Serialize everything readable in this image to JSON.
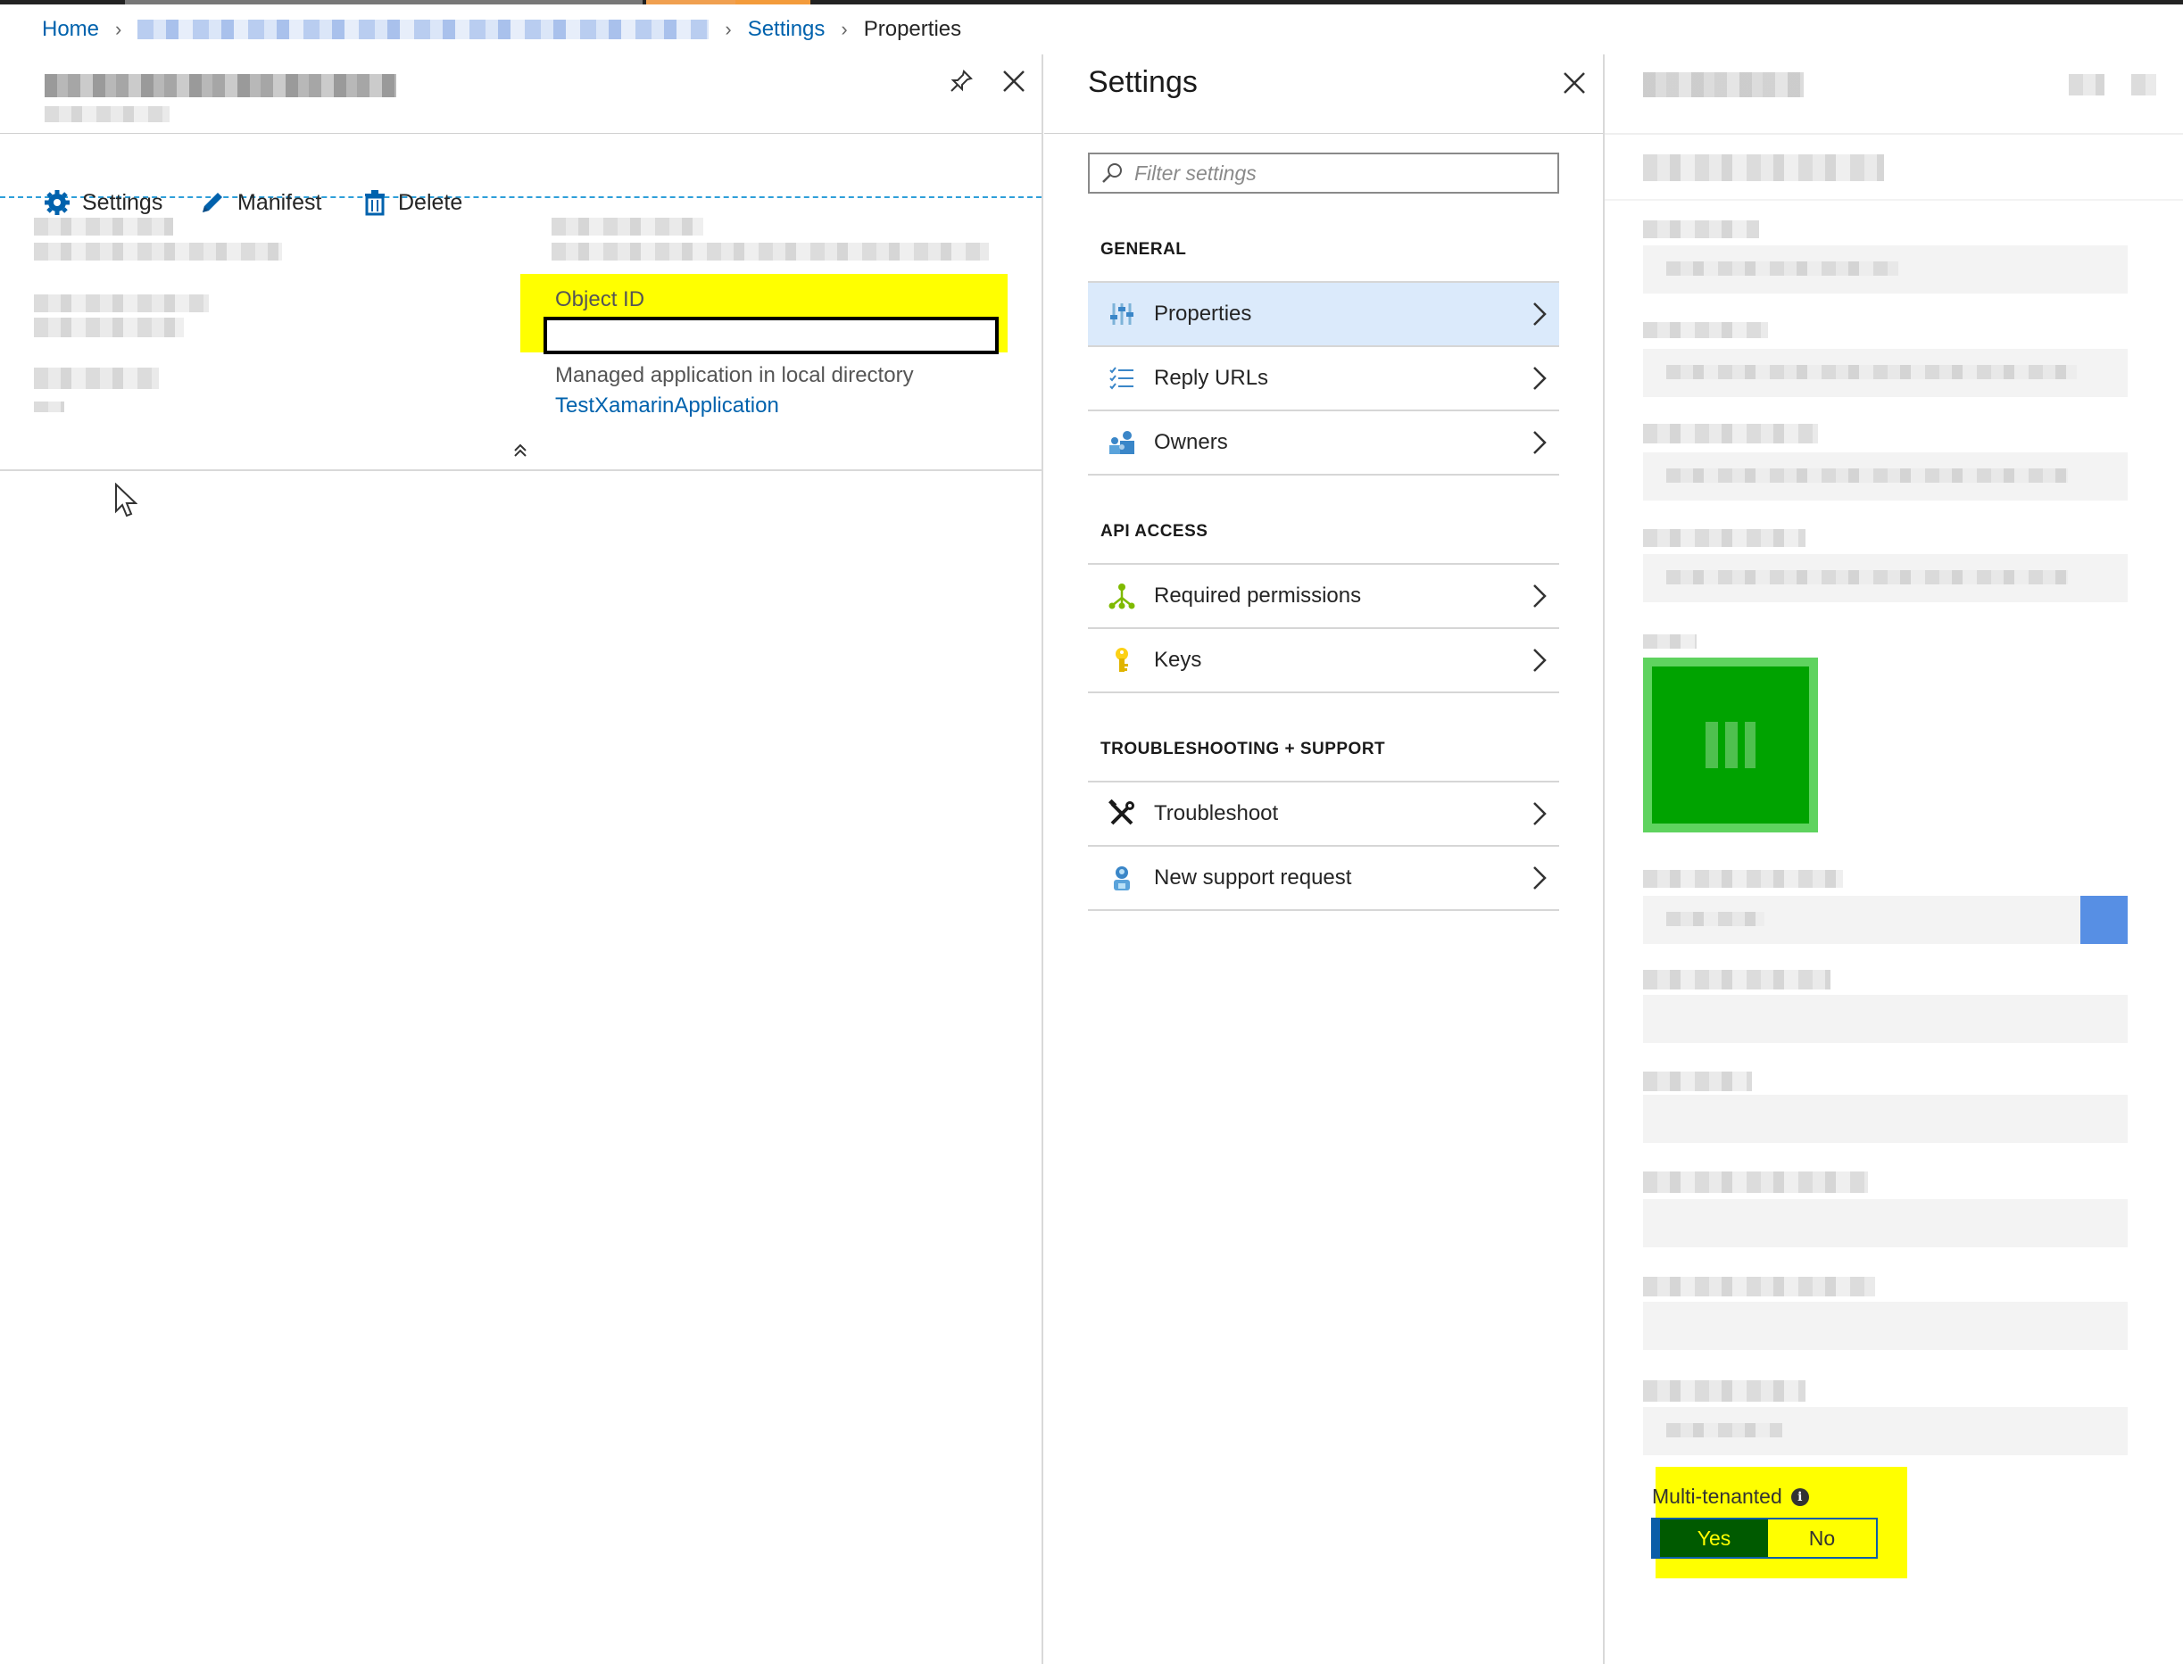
{
  "breadcrumb": {
    "home": "Home",
    "settings": "Settings",
    "current": "Properties"
  },
  "app_blade": {
    "toolbar": {
      "settings_label": "Settings",
      "manifest_label": "Manifest",
      "delete_label": "Delete"
    },
    "essentials": {
      "object_id_label": "Object ID",
      "object_id_value": "",
      "managed_app_label": "Managed application in local directory",
      "managed_app_link": "TestXamarinApplication"
    }
  },
  "settings_blade": {
    "title": "Settings",
    "filter_placeholder": "Filter settings",
    "sections": [
      {
        "heading": "GENERAL",
        "items": [
          {
            "label": "Properties",
            "icon": "properties-icon",
            "active": true
          },
          {
            "label": "Reply URLs",
            "icon": "list-icon"
          },
          {
            "label": "Owners",
            "icon": "owners-icon"
          }
        ]
      },
      {
        "heading": "API ACCESS",
        "items": [
          {
            "label": "Required permissions",
            "icon": "permissions-icon"
          },
          {
            "label": "Keys",
            "icon": "key-icon"
          }
        ]
      },
      {
        "heading": "TROUBLESHOOTING + SUPPORT",
        "items": [
          {
            "label": "Troubleshoot",
            "icon": "tools-icon"
          },
          {
            "label": "New support request",
            "icon": "support-icon"
          }
        ]
      }
    ]
  },
  "properties_blade": {
    "multi_tenanted_label": "Multi-tenanted",
    "toggle_yes": "Yes",
    "toggle_no": "No",
    "multi_tenanted_selected": "Yes"
  },
  "colors": {
    "link": "#0062ad",
    "highlight": "#ffff00",
    "active_item": "#dbeafb",
    "logo_green": "#00a300",
    "toggle_selected": "#005a00"
  }
}
